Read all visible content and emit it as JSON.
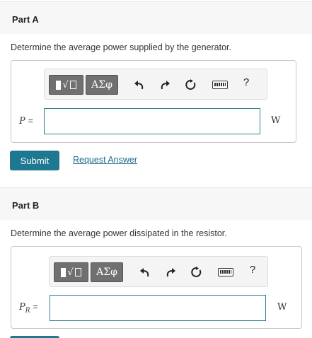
{
  "part_a": {
    "title": "Part A",
    "question": "Determine the average power supplied by the generator.",
    "toolbar": {
      "template_label": "√",
      "greek_label": "ΑΣφ",
      "help_label": "?"
    },
    "variable": "P",
    "equals": "=",
    "input_value": "",
    "unit": "W",
    "submit_label": "Submit",
    "request_label": "Request Answer"
  },
  "part_b": {
    "title": "Part B",
    "question": "Determine the average power dissipated in the resistor.",
    "toolbar": {
      "template_label": "√",
      "greek_label": "ΑΣφ",
      "help_label": "?"
    },
    "variable": "P",
    "variable_sub": "R",
    "equals": "=",
    "input_value": "",
    "unit": "W"
  },
  "icons": [
    "templates-icon",
    "greek-letters-icon",
    "undo-icon",
    "redo-icon",
    "reset-icon",
    "keyboard-icon",
    "help-icon"
  ]
}
